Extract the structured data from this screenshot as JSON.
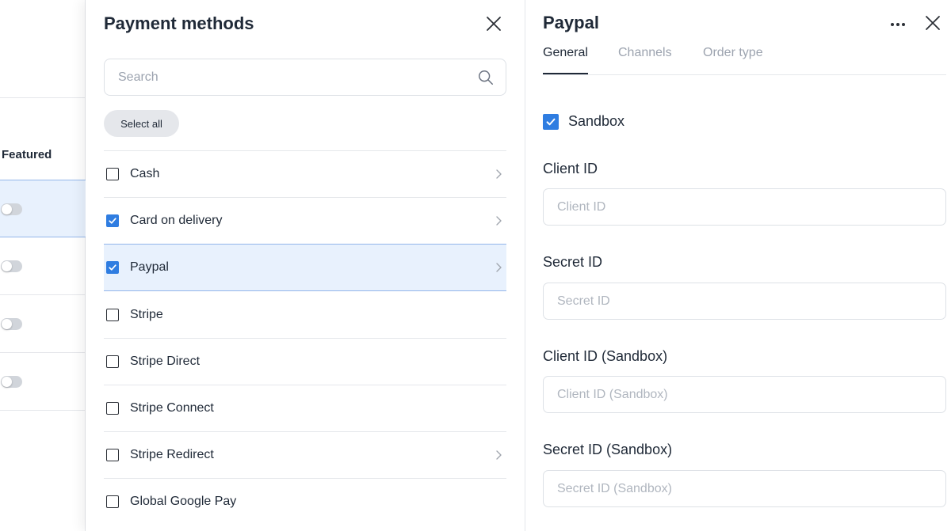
{
  "background": {
    "column_header": "Featured",
    "rows": [
      {
        "featured_on": false,
        "selected": true
      },
      {
        "featured_on": false,
        "selected": false
      },
      {
        "featured_on": false,
        "selected": false
      },
      {
        "featured_on": false,
        "selected": false
      }
    ]
  },
  "payment_methods": {
    "title": "Payment methods",
    "search_placeholder": "Search",
    "select_all_label": "Select all",
    "items": [
      {
        "label": "Cash",
        "checked": false,
        "has_chevron": true,
        "selected": false
      },
      {
        "label": "Card on delivery",
        "checked": true,
        "has_chevron": true,
        "selected": false
      },
      {
        "label": "Paypal",
        "checked": true,
        "has_chevron": true,
        "selected": true
      },
      {
        "label": "Stripe",
        "checked": false,
        "has_chevron": false,
        "selected": false
      },
      {
        "label": "Stripe Direct",
        "checked": false,
        "has_chevron": false,
        "selected": false
      },
      {
        "label": "Stripe Connect",
        "checked": false,
        "has_chevron": false,
        "selected": false
      },
      {
        "label": "Stripe Redirect",
        "checked": false,
        "has_chevron": true,
        "selected": false
      },
      {
        "label": "Global Google Pay",
        "checked": false,
        "has_chevron": false,
        "selected": false
      }
    ]
  },
  "detail": {
    "title": "Paypal",
    "tabs": [
      {
        "label": "General",
        "active": true
      },
      {
        "label": "Channels",
        "active": false
      },
      {
        "label": "Order type",
        "active": false
      }
    ],
    "sandbox": {
      "label": "Sandbox",
      "checked": true
    },
    "fields": [
      {
        "label": "Client ID",
        "placeholder": "Client ID",
        "value": ""
      },
      {
        "label": "Secret ID",
        "placeholder": "Secret ID",
        "value": ""
      },
      {
        "label": "Client ID (Sandbox)",
        "placeholder": "Client ID (Sandbox)",
        "value": ""
      },
      {
        "label": "Secret ID (Sandbox)",
        "placeholder": "Secret ID (Sandbox)",
        "value": ""
      }
    ]
  },
  "colors": {
    "accent": "#2f7de1",
    "selected_row_bg": "#e8f1fd",
    "selected_row_border": "#93b6ea",
    "text": "#1f2937",
    "muted_text": "#9ca3af"
  },
  "icons": {
    "close": "close-icon",
    "search": "search-icon",
    "chevron": "chevron-right-icon",
    "more": "more-horizontal-icon",
    "check": "check-icon"
  }
}
